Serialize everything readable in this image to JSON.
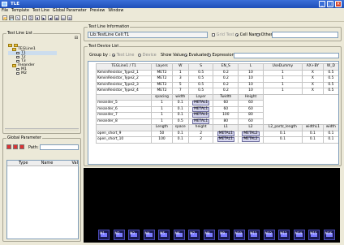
{
  "window": {
    "title": "TLE",
    "min": "_",
    "max": "□",
    "close": "×"
  },
  "menu": [
    "File",
    "Template",
    "Test Line",
    "Global Parameter",
    "Preview",
    "Window"
  ],
  "toolbar": [
    "📂",
    "💾",
    "✎",
    "✂",
    "⎘",
    "✖",
    "▶",
    "◀",
    "▦",
    "▤",
    "▥"
  ],
  "tree": {
    "panel_label": "Test Line List",
    "collapse": "⊟",
    "root": "TEGLine1",
    "children": [
      "T1",
      "T2",
      "T3"
    ],
    "group2": "meander",
    "group2_children": [
      "M1",
      "M2"
    ]
  },
  "global_param": {
    "panel_label": "Global Parameter",
    "path_label": "Path:",
    "cols": [
      "Type",
      "Name",
      "Val"
    ]
  },
  "info": {
    "panel_label": "Test Line Information",
    "field": "Lib:TestLine Cell:T1",
    "grid_test": "Grid Test",
    "cell_name": "Cell Name",
    "other": "Other"
  },
  "device_list": {
    "panel_label": "Test Device List",
    "group_by": "Group by :",
    "test_line": "Test Line",
    "device": "Device",
    "show_value": "Show Value :",
    "evaluated": "Evaluated",
    "expression": "Expression",
    "head1": [
      "TEGLine1 / T1",
      "Layers",
      "W",
      "S",
      "EN_S",
      "L",
      "UseDummy",
      "AX+BY",
      "W_D"
    ],
    "rows1": [
      [
        "KelvinResistor_Type2_1",
        "MET2",
        "1",
        "0.5",
        "0.2",
        "10",
        "1",
        "X",
        "0.5"
      ],
      [
        "KelvinResistor_Type2_2",
        "MET2",
        "3",
        "0.5",
        "0.2",
        "10",
        "1",
        "X",
        "0.5"
      ],
      [
        "KelvinResistor_Type2_3",
        "MET2",
        "5",
        "0.5",
        "0.2",
        "10",
        "1",
        "X",
        "0.5"
      ],
      [
        "KelvinResistor_Type2_4",
        "MET2",
        "7",
        "0.5",
        "0.2",
        "10",
        "1",
        "X",
        "0.5"
      ]
    ],
    "head2": [
      "",
      "spacing",
      "width",
      "Layer",
      "Twidth",
      "Height"
    ],
    "rows2": [
      [
        "meander_5",
        "1",
        "0.1",
        "METAL1",
        "60",
        "60"
      ],
      [
        "meander_6",
        "1",
        "0.1",
        "METAL1",
        "60",
        "60"
      ],
      [
        "meander_7",
        "1",
        "0.1",
        "METAL1",
        "100",
        "80"
      ],
      [
        "meander_8",
        "1",
        "0.5",
        "METAL1",
        "80",
        "60"
      ]
    ],
    "head3": [
      "",
      "Length",
      "space",
      "height",
      "L1",
      "L2",
      "L2_partz_length",
      "widthL1",
      "width"
    ],
    "rows3": [
      [
        "open_short_9",
        "50",
        "0.1",
        "2",
        "METAL1",
        "METAL2",
        "0.1",
        "0.1",
        "0.1"
      ],
      [
        "open_short_10",
        "100",
        "0.1",
        "2",
        "METAL1",
        "METAL2",
        "0.1",
        "0.1",
        "0.1"
      ]
    ]
  },
  "preview": {
    "chip_labels": [
      "M1",
      "M2",
      "M3",
      "M4",
      "M5",
      "M6",
      "M7",
      "M8",
      "M9",
      "M10",
      "M11",
      "M12",
      "M13",
      "M14",
      "M15",
      "M16"
    ]
  }
}
